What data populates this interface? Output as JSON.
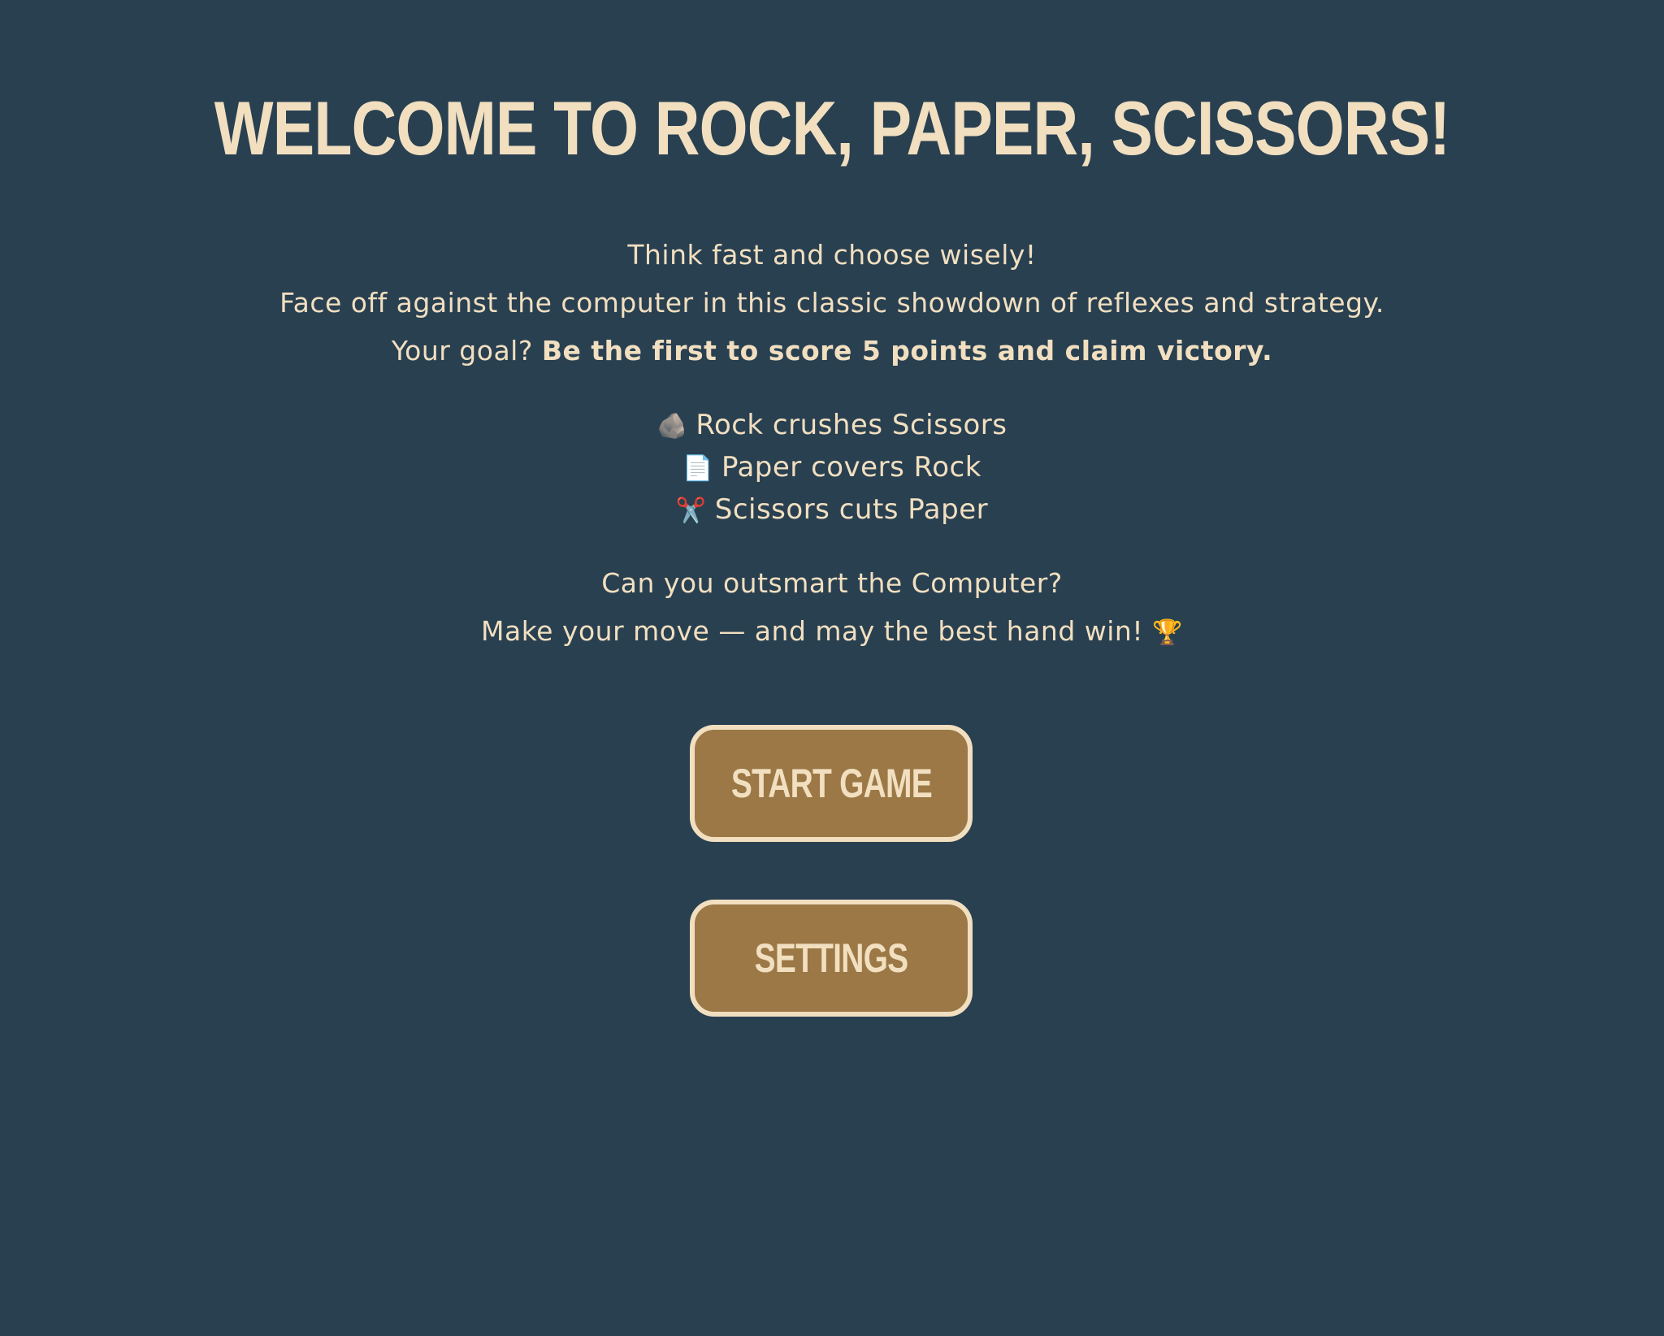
{
  "title": "WELCOME TO ROCK, PAPER, SCISSORS!",
  "intro": {
    "line1": "Think fast and choose wisely!",
    "line2": "Face off against the computer in this classic showdown of reflexes and strategy.",
    "line3_prefix": "Your goal? ",
    "line3_bold": "Be the first to score 5 points and claim victory."
  },
  "rules": [
    {
      "icon": "rock-icon",
      "emoji": "🪨",
      "text": "Rock crushes Scissors"
    },
    {
      "icon": "paper-icon",
      "emoji": "📄",
      "text": "Paper covers Rock"
    },
    {
      "icon": "scissors-icon",
      "emoji": "✂️",
      "text": "Scissors cuts Paper"
    }
  ],
  "outro": {
    "line1": "Can you outsmart the Computer?",
    "line2": "Make your move — and may the best hand win!",
    "trophy": "🏆"
  },
  "buttons": {
    "start": "START GAME",
    "settings": "SETTINGS"
  },
  "colors": {
    "background": "#294051",
    "text": "#f1dfc0",
    "button": "#9b7846"
  }
}
